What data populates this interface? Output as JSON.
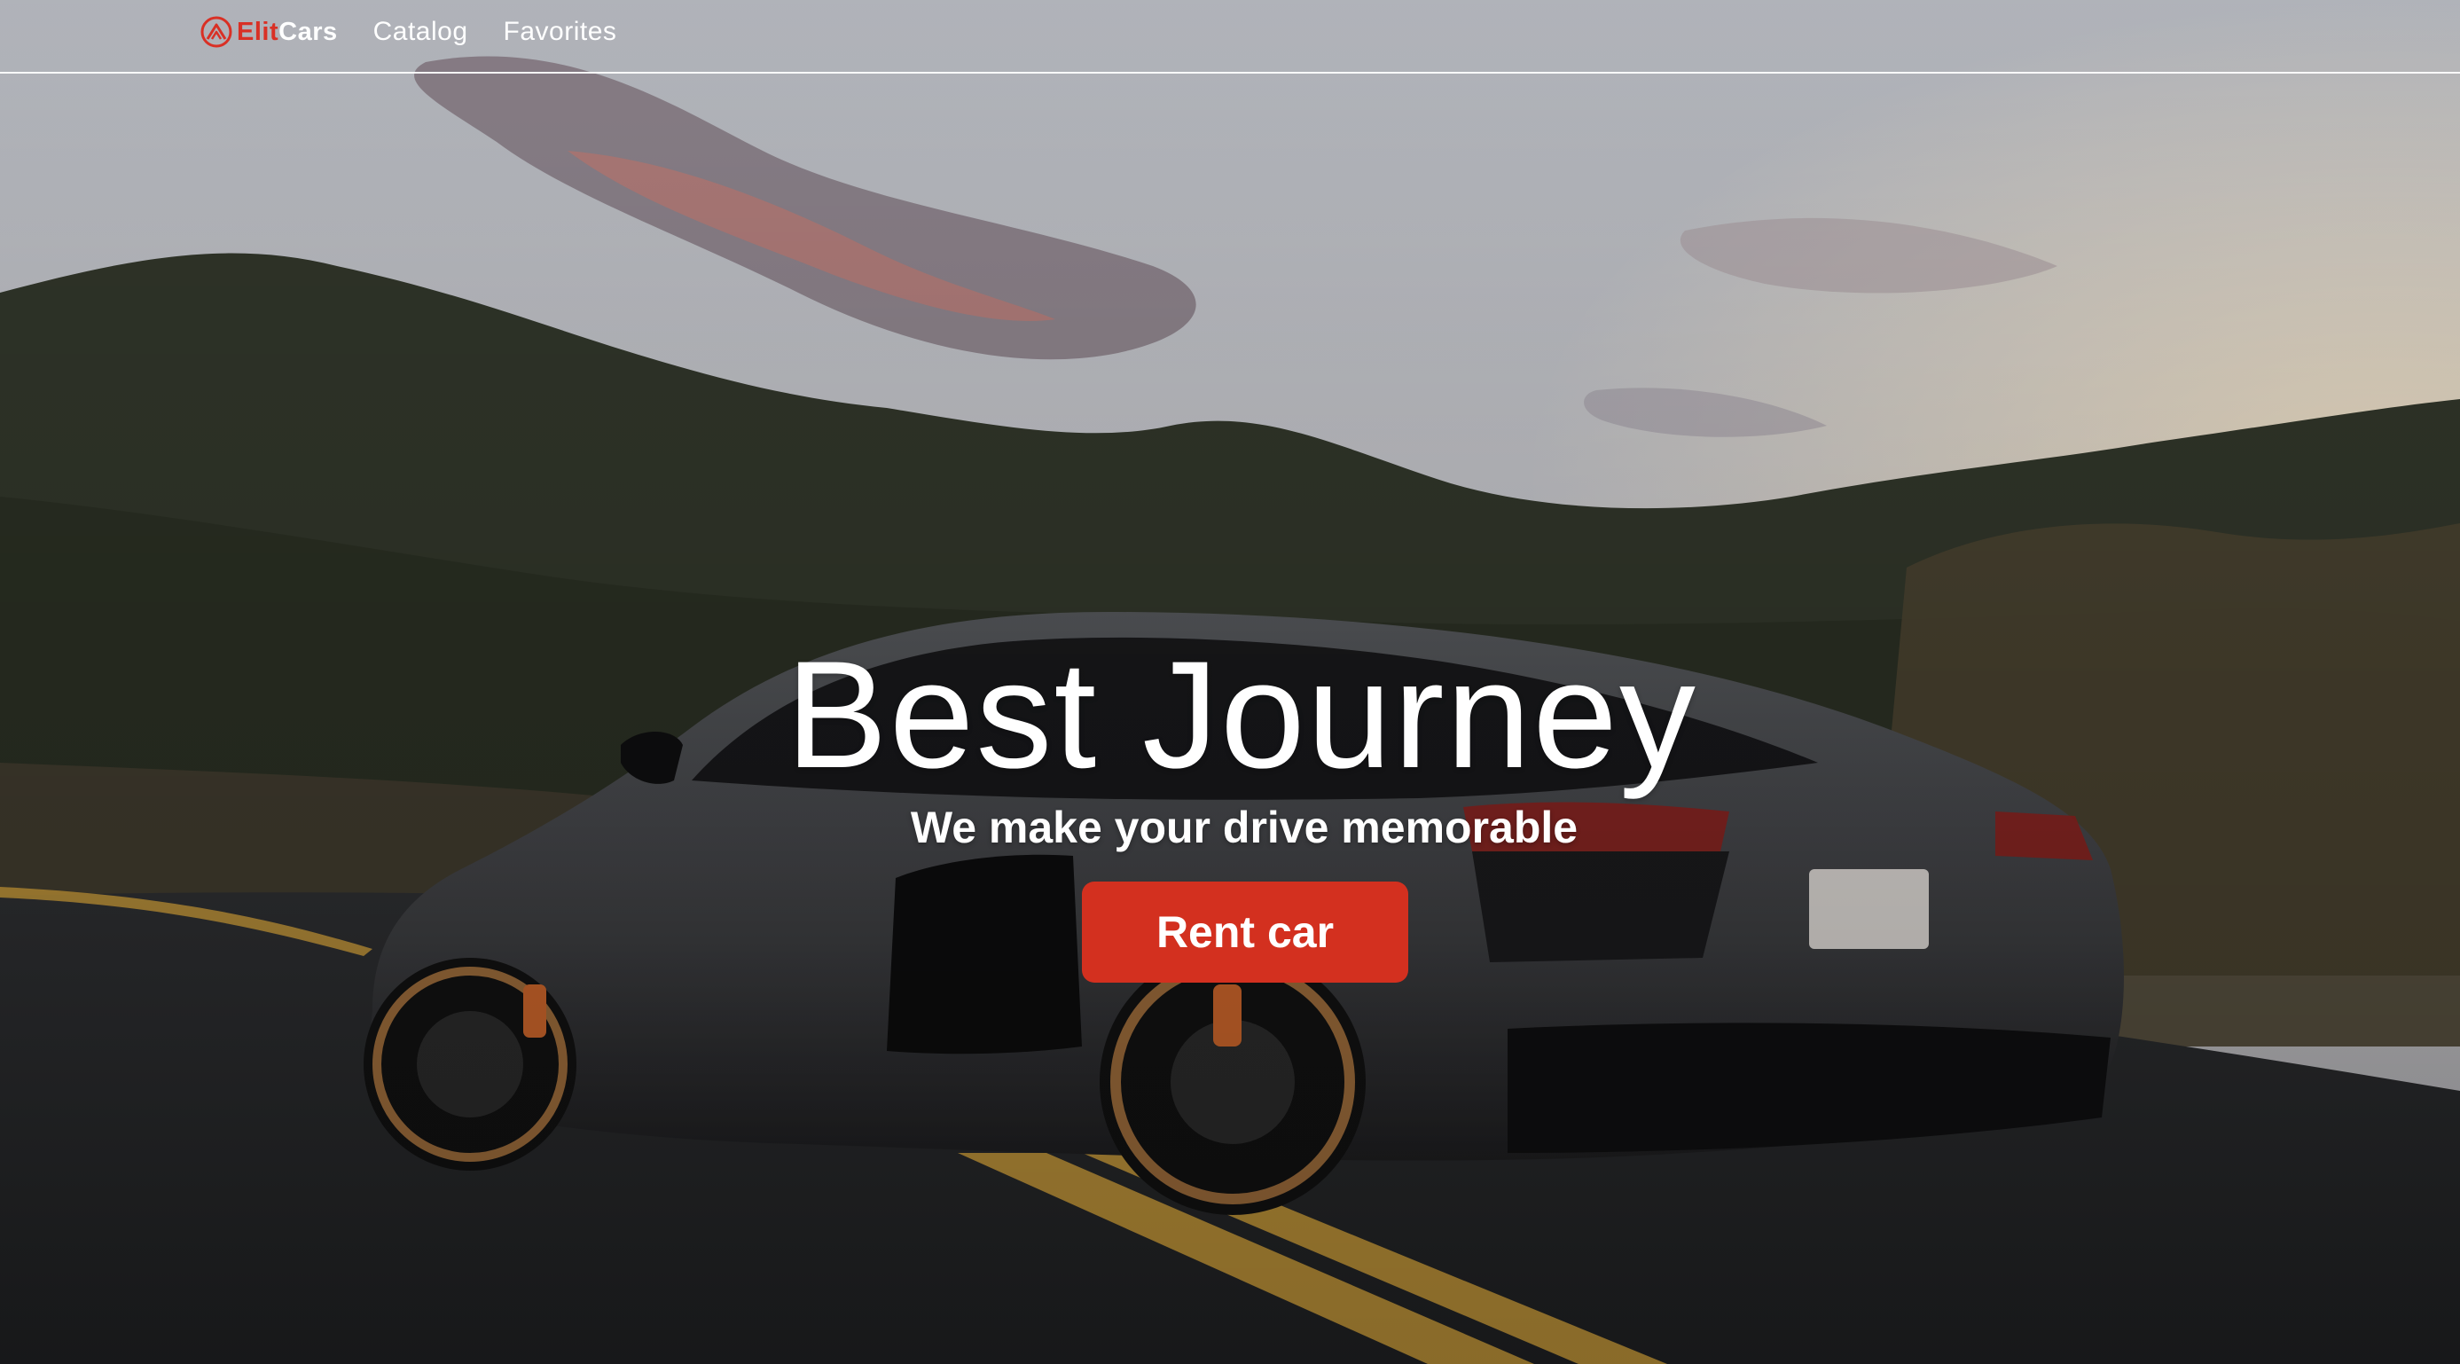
{
  "header": {
    "logo": {
      "part1": "Elit",
      "part2": "Cars",
      "icon": "logo-icon"
    },
    "nav": [
      {
        "label": "Catalog"
      },
      {
        "label": "Favorites"
      }
    ]
  },
  "hero": {
    "title": "Best Journey",
    "subtitle": "We make your drive memorable",
    "cta_label": "Rent car"
  },
  "colors": {
    "accent": "#d3301f",
    "text": "#ffffff"
  }
}
